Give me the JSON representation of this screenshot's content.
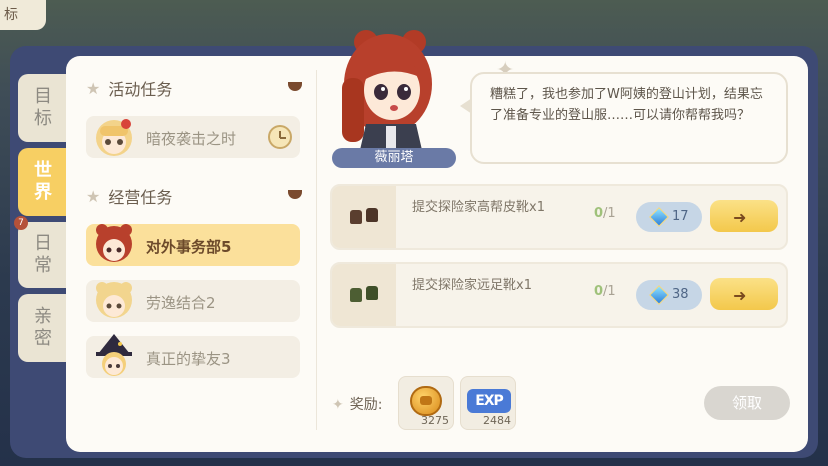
{
  "header": {
    "corner_tab_label": "标"
  },
  "side_tabs": [
    {
      "label": "目\n标",
      "active": false,
      "badge": ""
    },
    {
      "label": "世\n界",
      "active": true,
      "badge": ""
    },
    {
      "label": "日\n常",
      "active": false,
      "badge": "7"
    },
    {
      "label": "亲\n密",
      "active": false,
      "badge": ""
    }
  ],
  "task_list": {
    "sections": [
      {
        "title": "活动任务",
        "icon": "star-icon",
        "items": [
          {
            "label": "暗夜袭击之时",
            "avatar": "blonde-girl-avatar",
            "trailing_icon": "clock-icon"
          }
        ]
      },
      {
        "title": "经营任务",
        "icon": "star-icon",
        "items": [
          {
            "label": "对外事务部5",
            "avatar": "red-hair-girl-avatar",
            "selected": true
          },
          {
            "label": "劳逸结合2",
            "avatar": "blonde-girl-avatar"
          },
          {
            "label": "真正的挚友3",
            "avatar": "witch-girl-avatar"
          }
        ]
      }
    ]
  },
  "npc": {
    "name": "薇丽塔",
    "dialog": "糟糕了，我也参加了W阿姨的登山计划，结果忘了准备专业的登山服……可以请你帮帮我吗？"
  },
  "quests": [
    {
      "text": "提交探险家高帮皮靴x1",
      "progress_current": "0",
      "progress_total": "/1",
      "gem_cost": "17",
      "icon": "brown-boots-icon"
    },
    {
      "text": "提交探险家远足靴x1",
      "progress_current": "0",
      "progress_total": "/1",
      "gem_cost": "38",
      "icon": "green-boots-icon"
    }
  ],
  "rewards": {
    "label": "奖励:",
    "items": [
      {
        "icon": "coin-icon",
        "amount": "3275"
      },
      {
        "icon": "exp-icon",
        "text": "EXP",
        "amount": "2484"
      }
    ]
  },
  "claim_button": {
    "label": "领取",
    "enabled": false
  },
  "colors": {
    "accent": "#f7cf63",
    "panel": "#3e4a74",
    "content_bg": "#fdfbf6",
    "npc_name_bg": "#6a7aa6"
  }
}
